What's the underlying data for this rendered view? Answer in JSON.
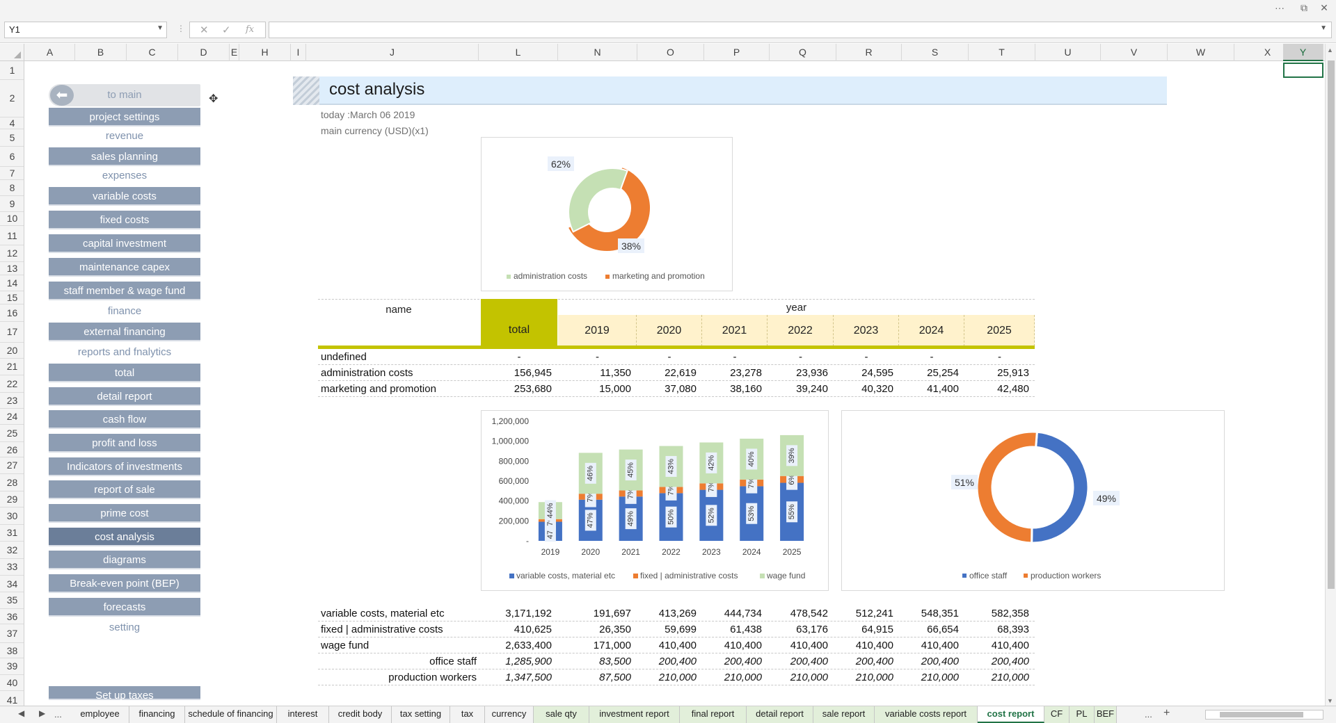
{
  "window": {
    "more": "···",
    "restore": "⧉",
    "close": "✕"
  },
  "formula_bar": {
    "name_box": "Y1",
    "cancel": "✕",
    "enter": "✓",
    "fx": "fx",
    "formula": ""
  },
  "columns": [
    "A",
    "B",
    "C",
    "D",
    "E",
    "H",
    "I",
    "J",
    "L",
    "N",
    "O",
    "P",
    "Q",
    "R",
    "S",
    "T",
    "U",
    "V",
    "W",
    "X",
    "Y"
  ],
  "rows": [
    "1",
    "2",
    "4",
    "5",
    "6",
    "7",
    "8",
    "9",
    "10",
    "11",
    "12",
    "13",
    "14",
    "15",
    "16",
    "17",
    "20",
    "21",
    "22",
    "23",
    "24",
    "25",
    "26",
    "27",
    "28",
    "29",
    "30",
    "31",
    "32",
    "33",
    "34",
    "35",
    "36",
    "37",
    "38",
    "39",
    "40",
    "41"
  ],
  "nav": {
    "to_main": "to main",
    "project_settings": "project settings",
    "revenue": "revenue",
    "sales_planning": "sales planning",
    "expenses": "expenses",
    "variable_costs": "variable costs",
    "fixed_costs": "fixed costs",
    "capital_investment": "capital investment",
    "maintenance_capex": "maintenance capex",
    "staff_member": "staff member & wage fund",
    "finance": "finance",
    "external_financing": "external financing",
    "reports": "reports and fnalytics",
    "total": "total",
    "detail_report": "detail report",
    "cash_flow": "cash flow",
    "profit_and_loss": "profit and loss",
    "indicators": "Indicators of investments",
    "report_of_sale": "report of sale",
    "prime_cost": "prime cost",
    "cost_analysis": "cost analysis",
    "diagrams": "diagrams",
    "bep": "Break-even point (BEP)",
    "forecasts": "forecasts",
    "setting": "setting",
    "set_up_taxes": "Set up taxes"
  },
  "header": {
    "title": "cost analysis",
    "today": "today :March 06 2019",
    "currency": "main currency (USD)(x1)"
  },
  "table_header": {
    "name": "name",
    "total": "total",
    "year": "year",
    "years": [
      "2019",
      "2020",
      "2021",
      "2022",
      "2023",
      "2024",
      "2025"
    ]
  },
  "table1": [
    {
      "name": "undefined",
      "total": "-",
      "values": [
        "-",
        "-",
        "-",
        "-",
        "-",
        "-",
        "-"
      ]
    },
    {
      "name": "administration costs",
      "total": "156,945",
      "values": [
        "11,350",
        "22,619",
        "23,278",
        "23,936",
        "24,595",
        "25,254",
        "25,913"
      ]
    },
    {
      "name": "marketing and promotion",
      "total": "253,680",
      "values": [
        "15,000",
        "37,080",
        "38,160",
        "39,240",
        "40,320",
        "41,400",
        "42,480"
      ]
    }
  ],
  "table2": [
    {
      "name": "variable costs, material etc",
      "total": "3,171,192",
      "values": [
        "191,697",
        "413,269",
        "444,734",
        "478,542",
        "512,241",
        "548,351",
        "582,358"
      ]
    },
    {
      "name": "fixed | administrative costs",
      "total": "410,625",
      "values": [
        "26,350",
        "59,699",
        "61,438",
        "63,176",
        "64,915",
        "66,654",
        "68,393"
      ]
    },
    {
      "name": "wage fund",
      "total": "2,633,400",
      "values": [
        "171,000",
        "410,400",
        "410,400",
        "410,400",
        "410,400",
        "410,400",
        "410,400"
      ]
    },
    {
      "name": "office staff",
      "total": "1,285,900",
      "values": [
        "83,500",
        "200,400",
        "200,400",
        "200,400",
        "200,400",
        "200,400",
        "200,400"
      ]
    },
    {
      "name": "production workers",
      "total": "1,347,500",
      "values": [
        "87,500",
        "210,000",
        "210,000",
        "210,000",
        "210,000",
        "210,000",
        "210,000"
      ]
    }
  ],
  "chart_data": [
    {
      "type": "pie",
      "title": "",
      "labels": [
        "administration costs",
        "marketing and promotion"
      ],
      "values": [
        38,
        62
      ],
      "data_labels": [
        "38%",
        "62%"
      ],
      "colors": [
        "#c5e0b4",
        "#ed7d31"
      ],
      "legend": "bottom"
    },
    {
      "type": "bar",
      "title": "",
      "categories": [
        "2019",
        "2020",
        "2021",
        "2022",
        "2023",
        "2024",
        "2025"
      ],
      "series": [
        {
          "name": "variable costs, material etc",
          "values": [
            191697,
            413269,
            444734,
            478542,
            512241,
            548351,
            582358
          ],
          "labels": [
            "47%",
            "47%",
            "49%",
            "50%",
            "52%",
            "53%",
            "55%"
          ]
        },
        {
          "name": "fixed | administrative costs",
          "values": [
            26350,
            59699,
            61438,
            63176,
            64915,
            66654,
            68393
          ],
          "labels": [
            "7%",
            "7%",
            "7%",
            "7%",
            "7%",
            "7%",
            "6%"
          ]
        },
        {
          "name": "wage fund",
          "values": [
            171000,
            410400,
            410400,
            410400,
            410400,
            410400,
            410400
          ],
          "labels": [
            "44%",
            "46%",
            "45%",
            "43%",
            "42%",
            "40%",
            "39%"
          ]
        }
      ],
      "yticks": [
        "-",
        "200,000",
        "400,000",
        "600,000",
        "800,000",
        "1,000,000",
        "1,200,000"
      ],
      "ylim": [
        0,
        1200000
      ],
      "colors": [
        "#4472c4",
        "#ed7d31",
        "#c5e0b4"
      ],
      "legend": "bottom",
      "stacked": true
    },
    {
      "type": "pie",
      "title": "",
      "labels": [
        "office staff",
        "production workers"
      ],
      "values": [
        49,
        51
      ],
      "data_labels": [
        "49%",
        "51%"
      ],
      "colors": [
        "#4472c4",
        "#ed7d31"
      ],
      "legend": "bottom"
    }
  ],
  "sheet_tabs": {
    "ellipsis": "...",
    "tabs": [
      {
        "label": "employee",
        "green": false
      },
      {
        "label": "financing",
        "green": false
      },
      {
        "label": "schedule of financing",
        "green": false
      },
      {
        "label": "interest",
        "green": false
      },
      {
        "label": "credit body",
        "green": false
      },
      {
        "label": "tax setting",
        "green": false
      },
      {
        "label": "tax",
        "green": false
      },
      {
        "label": "currency",
        "green": false
      },
      {
        "label": "sale qty",
        "green": true
      },
      {
        "label": "investment report",
        "green": true
      },
      {
        "label": "final report",
        "green": true
      },
      {
        "label": "detail report",
        "green": true
      },
      {
        "label": "sale report",
        "green": true
      },
      {
        "label": "variable costs report",
        "green": true
      },
      {
        "label": "cost report",
        "green": false,
        "active": true
      },
      {
        "label": "CF",
        "green": true
      },
      {
        "label": "PL",
        "green": true
      },
      {
        "label": "BEF",
        "green": true
      }
    ],
    "more": "...",
    "add": "+"
  }
}
